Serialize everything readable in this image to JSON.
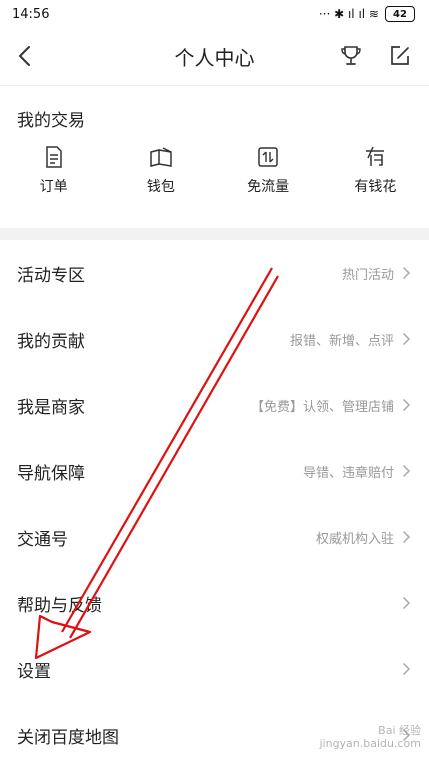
{
  "status_bar": {
    "time": "14:56",
    "signal_glyphs": "··· ✱ ıl ıl ≋",
    "battery": "42"
  },
  "header": {
    "title": "个人中心",
    "icons": {
      "back": "chevron-left-icon",
      "trophy": "trophy-icon",
      "edit": "edit-icon"
    }
  },
  "trade": {
    "title": "我的交易",
    "items": [
      {
        "label": "订单",
        "icon": "order-icon"
      },
      {
        "label": "钱包",
        "icon": "wallet-icon"
      },
      {
        "label": "免流量",
        "icon": "free-data-icon"
      },
      {
        "label": "有钱花",
        "icon": "credit-icon"
      }
    ]
  },
  "menu": {
    "items": [
      {
        "label": "活动专区",
        "hint": "热门活动"
      },
      {
        "label": "我的贡献",
        "hint": "报错、新增、点评"
      },
      {
        "label": "我是商家",
        "hint": "【免费】认领、管理店铺"
      },
      {
        "label": "导航保障",
        "hint": "导错、违章赔付"
      },
      {
        "label": "交通号",
        "hint": "权威机构入驻"
      },
      {
        "label": "帮助与反馈",
        "hint": ""
      },
      {
        "label": "设置",
        "hint": ""
      },
      {
        "label": "关闭百度地图",
        "hint": ""
      }
    ]
  },
  "colors": {
    "annotation": "#e01010",
    "hint": "#999999",
    "band": "#f2f2f2"
  },
  "watermark": {
    "line1": "Bai 经验",
    "line2": "jingyan.baidu.com"
  }
}
